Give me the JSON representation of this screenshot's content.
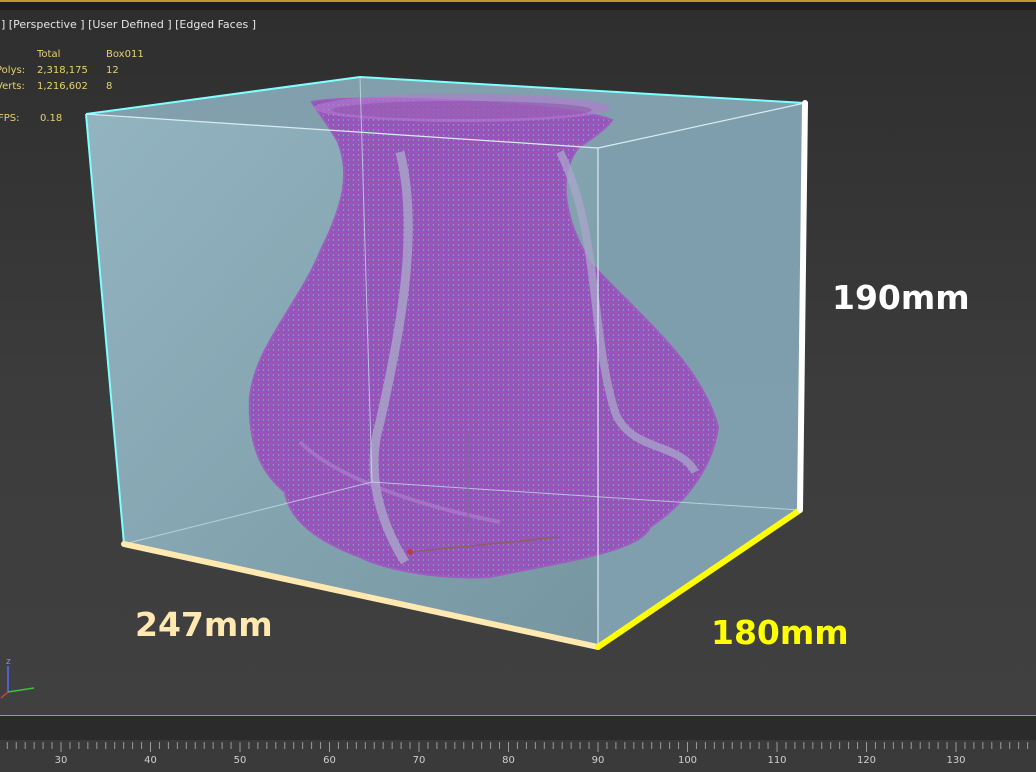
{
  "viewport": {
    "label_parts": [
      "]",
      "[Perspective ]",
      "[User Defined ]",
      "[Edged Faces ]"
    ],
    "stats": {
      "header_total": "Total",
      "header_object": "Box011",
      "polys_label": "Polys:",
      "polys_total": "2,318,175",
      "polys_object": "12",
      "verts_label": "Verts:",
      "verts_total": "1,216,602",
      "verts_object": "8",
      "fps_label": "FPS:",
      "fps_value": "0.18"
    },
    "gizmo_axis_label": "z"
  },
  "dimensions": {
    "height": "190mm",
    "width": "247mm",
    "depth": "180mm"
  },
  "colors": {
    "stats_text": "#e6d36a",
    "box_fill": "#8fb4c4",
    "box_edge_selected": "#7fffff",
    "vase": "#a455c2",
    "width_edge": "#ffe9b0",
    "depth_edge": "#ffff00",
    "height_edge": "#ffffff",
    "viewport_border": "#b89a2e"
  },
  "timeline": {
    "ticks": [
      "30",
      "40",
      "50",
      "60",
      "70",
      "80",
      "90",
      "100",
      "110",
      "120",
      "130"
    ]
  }
}
